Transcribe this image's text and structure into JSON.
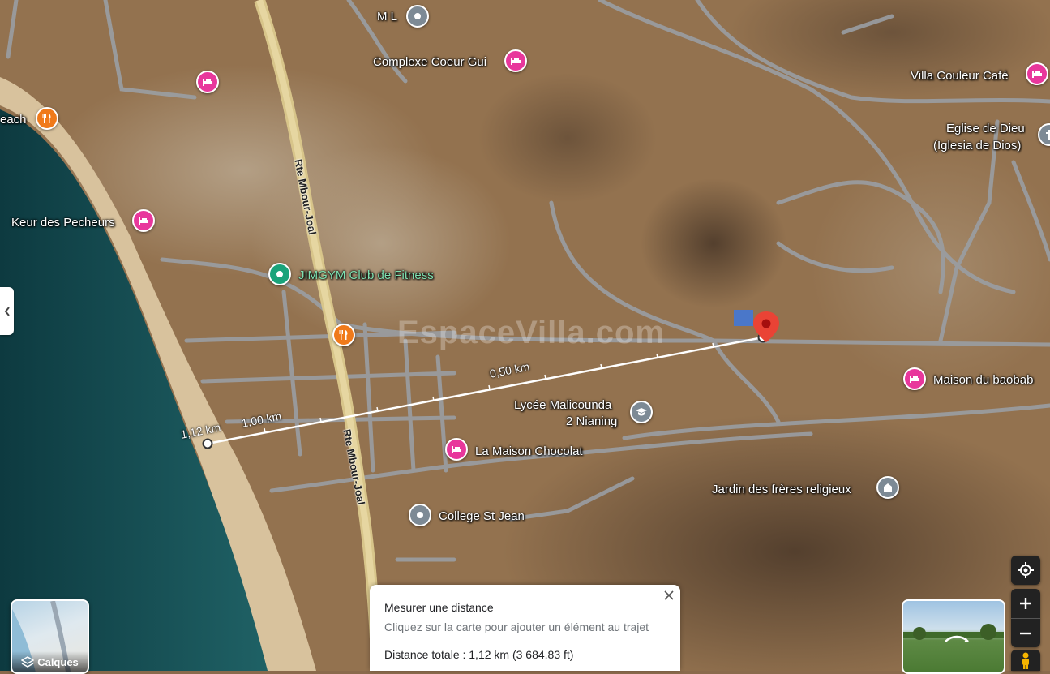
{
  "map": {
    "roads": {
      "main_road": "Rte Mbour-Joal",
      "main_road_lower": "Rte Mbour-Joal"
    },
    "watermark": "EspaceVilla.com",
    "places": {
      "ml": "M L",
      "coeur_gui": "Complexe Coeur Gui",
      "villa_couleur": "Villa Couleur Café",
      "beach": "each",
      "eglise_line1": "Eglise de Dieu",
      "eglise_line2": "(Iglesia de Dios)",
      "keur_pecheurs": "Keur des Pecheurs",
      "jimgym": "JIMGYM Club de Fitness",
      "maison_baobab": "Maison du baobab",
      "lycee_line1": "Lycée Malicounda",
      "lycee_line2": "2 Nianing",
      "maison_chocolat": "La Maison Chocolat",
      "jardin": "Jardin des frères religieux",
      "college": "College St Jean"
    },
    "measure": {
      "label_050": "0,50 km",
      "label_100": "1,00 km",
      "label_112": "1,12 km"
    }
  },
  "controls": {
    "layers_label": "Calques"
  },
  "measure_panel": {
    "title": "Mesurer une distance",
    "hint": "Cliquez sur la carte pour ajouter un élément au trajet",
    "total": "Distance totale : 1,12 km (3 684,83 ft)"
  },
  "colors": {
    "hotel_pin": "#e8379c",
    "food_pin": "#f07a1a",
    "generic_pin": "#7d8a95",
    "fitness_pin": "#1aa37a",
    "marker_red": "#ea4335",
    "measure_line": "#ffffff"
  }
}
